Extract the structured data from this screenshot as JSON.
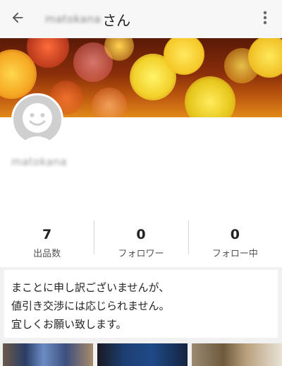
{
  "header": {
    "username_blurred": "matokana",
    "title_suffix": "さん",
    "back_icon": "arrow-left-icon",
    "menu_icon": "more-vert-icon"
  },
  "profile": {
    "name_blurred": "matokana",
    "avatar_icon": "default-avatar-icon"
  },
  "stats": [
    {
      "value": "7",
      "label": "出品数"
    },
    {
      "value": "0",
      "label": "フォロワー"
    },
    {
      "value": "0",
      "label": "フォロー中"
    }
  ],
  "message": {
    "lines": [
      "まことに申し訳ございませんが、",
      "値引き交渉には応じられません。",
      "宜しくお願い致します。"
    ]
  },
  "colors": {
    "header_bg": "#f7f7f7",
    "page_bg": "#f1f1f1",
    "card_bg": "#ffffff",
    "divider": "#d6d6d6",
    "avatar_bg": "#cfcfcf"
  }
}
